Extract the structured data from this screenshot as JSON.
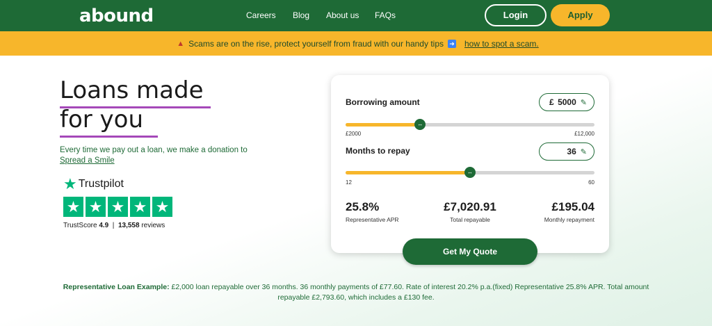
{
  "header": {
    "logo": "abound",
    "nav": [
      "Careers",
      "Blog",
      "About us",
      "FAQs"
    ],
    "login_label": "Login",
    "apply_label": "Apply"
  },
  "banner": {
    "message": "Scams are on the rise, protect yourself from fraud with our handy tips",
    "link_text": "how to spot a scam."
  },
  "hero": {
    "title_line1": "Loans made",
    "title_line2": "for you",
    "donation_text": "Every time we pay out a loan, we make a donation to",
    "donation_link": "Spread a Smile"
  },
  "trustpilot": {
    "brand": "Trustpilot",
    "score_label": "TrustScore",
    "score": "4.9",
    "separator": "|",
    "reviews_count": "13,558",
    "reviews_label": "reviews",
    "stars_rating": 5
  },
  "calculator": {
    "borrowing_label": "Borrowing amount",
    "currency": "£",
    "borrowing_value": "5000",
    "borrow_min": "£2000",
    "borrow_max": "£12,000",
    "borrow_fraction": 0.3,
    "months_label": "Months to repay",
    "months_value": "36",
    "months_min": "12",
    "months_max": "60",
    "months_fraction": 0.5,
    "apr_value": "25.8%",
    "apr_label": "Representative APR",
    "total_value": "£7,020.91",
    "total_label": "Total repayable",
    "monthly_value": "£195.04",
    "monthly_label": "Monthly repayment"
  },
  "cta": {
    "quote_label": "Get My Quote"
  },
  "footer": {
    "example_title": "Representative Loan Example:",
    "example_text": "£2,000 loan repayable over 36 months. 36 monthly payments of £77.60. Rate of interest 20.2% p.a.(fixed) Representative 25.8% APR. Total amount repayable £2,793.60, which includes a £130 fee."
  },
  "colors": {
    "brand_green": "#1e6a36",
    "accent_yellow": "#f7b62b",
    "underline_purple": "#a548b9",
    "trustpilot_green": "#00b67a"
  }
}
